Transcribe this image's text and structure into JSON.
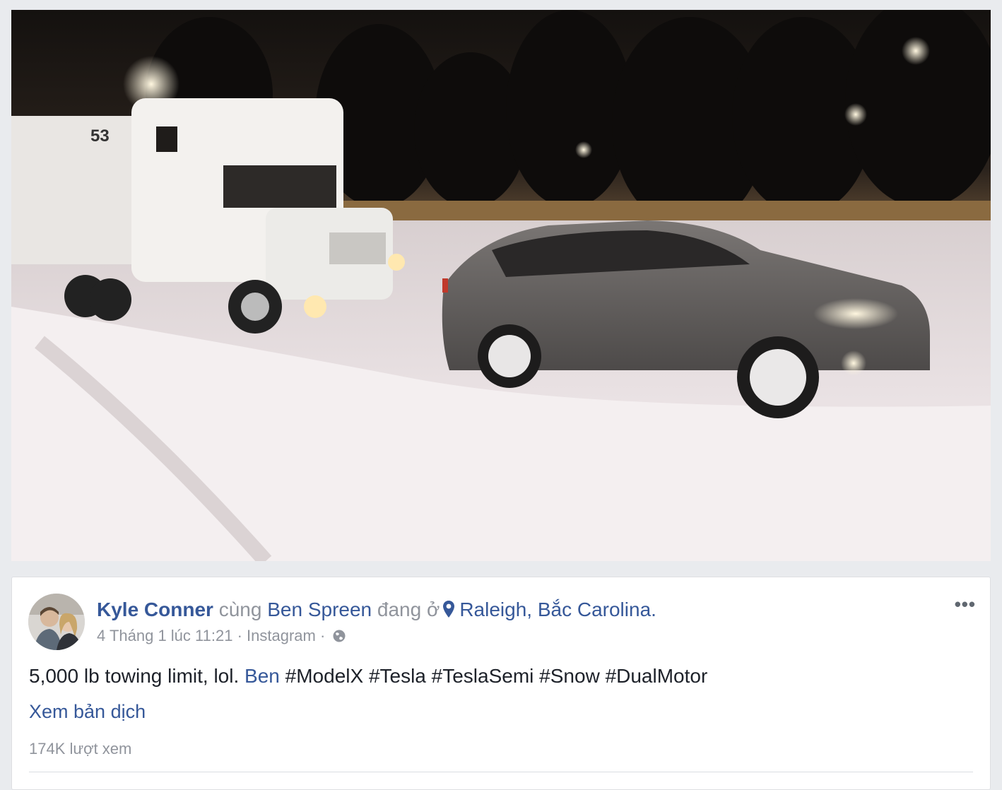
{
  "video": {
    "truck_number": "53"
  },
  "post": {
    "author": "Kyle Conner",
    "with_word": "cùng",
    "tagged": "Ben Spreen",
    "at_word": "đang ở",
    "location": "Raleigh, Bắc Carolina.",
    "timestamp": "4 Tháng 1 lúc 11:21",
    "separator": "·",
    "source": "Instagram",
    "more_label": "•••",
    "text_prefix": "5,000 lb towing limit, lol.",
    "mention": "Ben",
    "hashtags": "#ModelX #Tesla #TeslaSemi #Snow #DualMotor",
    "translate_label": "Xem bản dịch",
    "views": "174K lượt xem"
  },
  "colors": {
    "link": "#365899",
    "muted": "#90949c",
    "text": "#1d2129",
    "page_bg": "#e9ebee"
  },
  "icons": [
    "location-pin-icon",
    "globe-icon",
    "more-options-icon"
  ]
}
